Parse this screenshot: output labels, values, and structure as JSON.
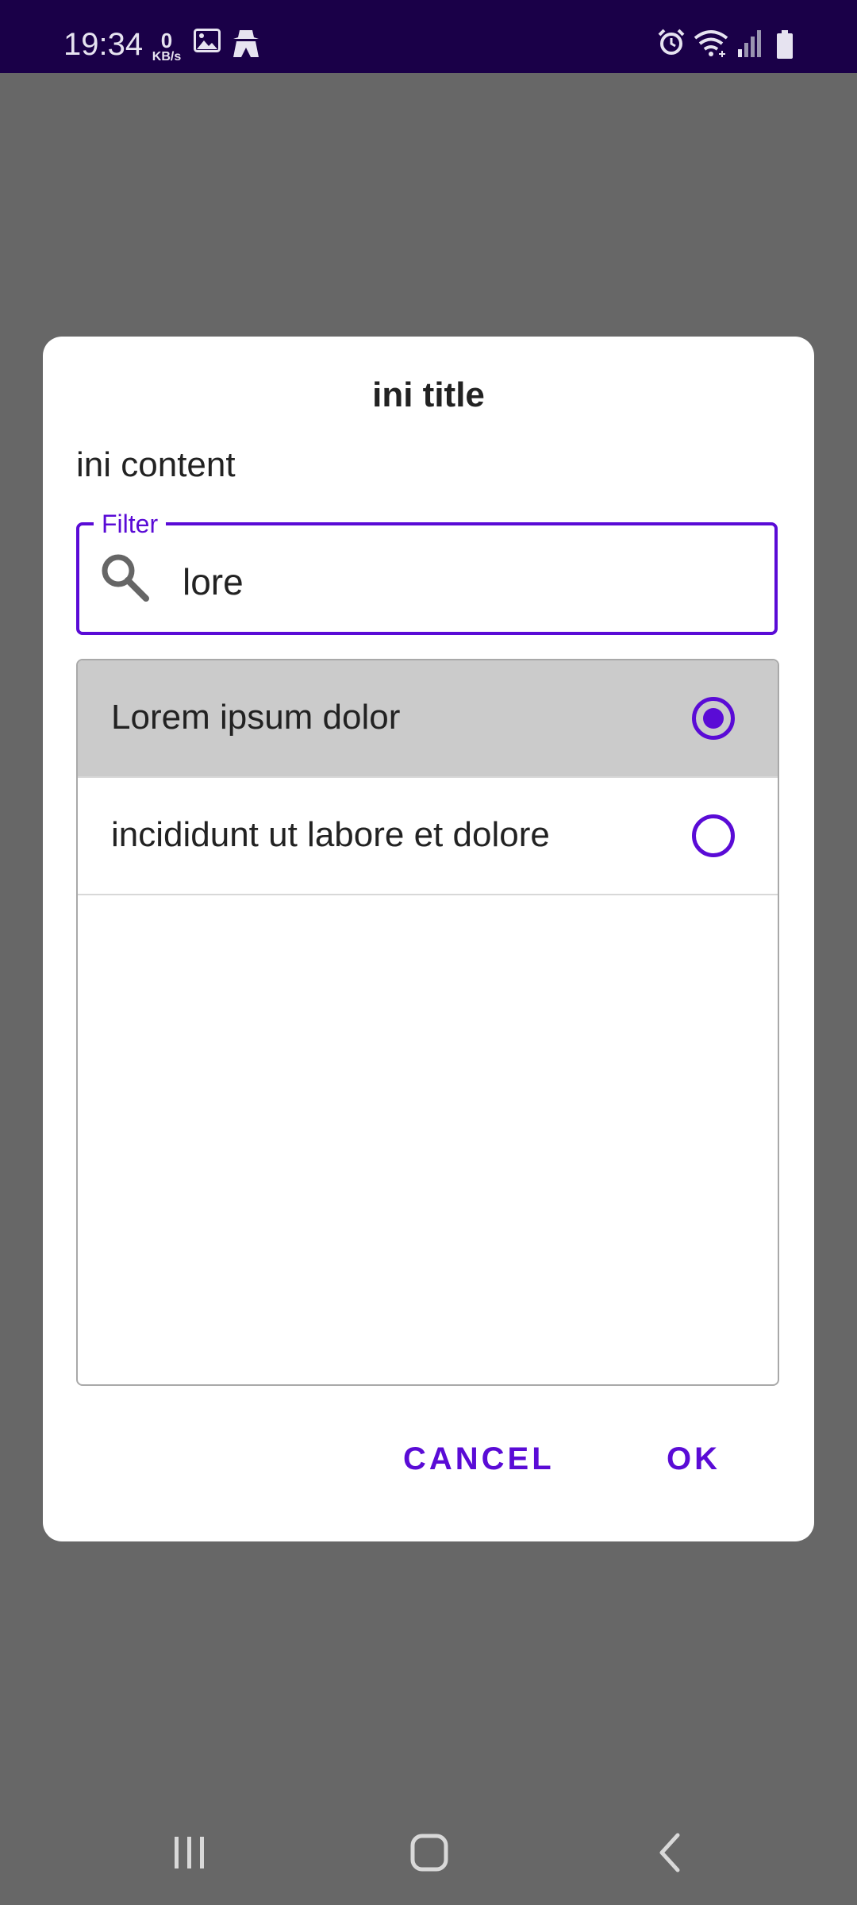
{
  "status_bar": {
    "time": "19:34",
    "net_speed_value": "0",
    "net_speed_unit": "KB/s",
    "left_icons": [
      "image-icon",
      "incognito-icon"
    ],
    "right_icons": [
      "alarm-icon",
      "wifi-icon",
      "signal-icon",
      "battery-icon"
    ],
    "background_color": "#1a0048"
  },
  "dialog": {
    "title": "ini title",
    "content": "ini content",
    "filter": {
      "label": "Filter",
      "value": "lore",
      "icon": "search-icon"
    },
    "items": [
      {
        "label": "Lorem ipsum dolor",
        "selected": true
      },
      {
        "label": "incididunt ut labore et dolore",
        "selected": false
      }
    ],
    "cancel_label": "CANCEL",
    "ok_label": "OK",
    "accent_color": "#5a0bd6"
  },
  "nav_bar": {
    "icons": [
      "recents-icon",
      "home-icon",
      "back-icon"
    ]
  }
}
